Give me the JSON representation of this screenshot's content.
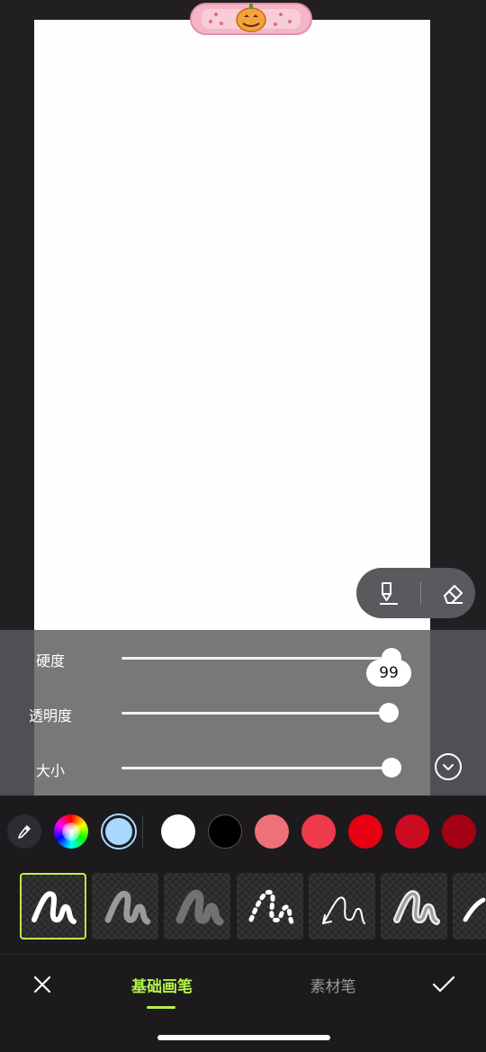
{
  "sliders": [
    {
      "label": "硬度",
      "value": 99
    },
    {
      "label": "透明度",
      "value": 99
    },
    {
      "label": "大小",
      "value": 100
    }
  ],
  "tooltip_value": "99",
  "palette": {
    "current_color": "#a9d8ff",
    "swatches": [
      "#ffffff",
      "#000000",
      "#f0707a",
      "#ee3a4c",
      "#e60012",
      "#cc0a20",
      "#a50014"
    ]
  },
  "brushes": [
    {
      "name": "solid-brush",
      "selected": true
    },
    {
      "name": "sparkle-brush",
      "selected": false
    },
    {
      "name": "blur-brush",
      "selected": false
    },
    {
      "name": "dashed-brush",
      "selected": false
    },
    {
      "name": "arrow-brush",
      "selected": false
    },
    {
      "name": "neon-brush",
      "selected": false
    },
    {
      "name": "partial-brush",
      "selected": false
    }
  ],
  "tabs": {
    "basic": "基础画笔",
    "material": "素材笔"
  },
  "icons": {
    "close": "close-icon",
    "confirm": "checkmark-icon",
    "pen": "pen-tool-icon",
    "eraser": "eraser-icon",
    "eyedropper": "eyedropper-icon",
    "collapse": "chevron-down-icon"
  },
  "accent_color": "#b4f24a"
}
